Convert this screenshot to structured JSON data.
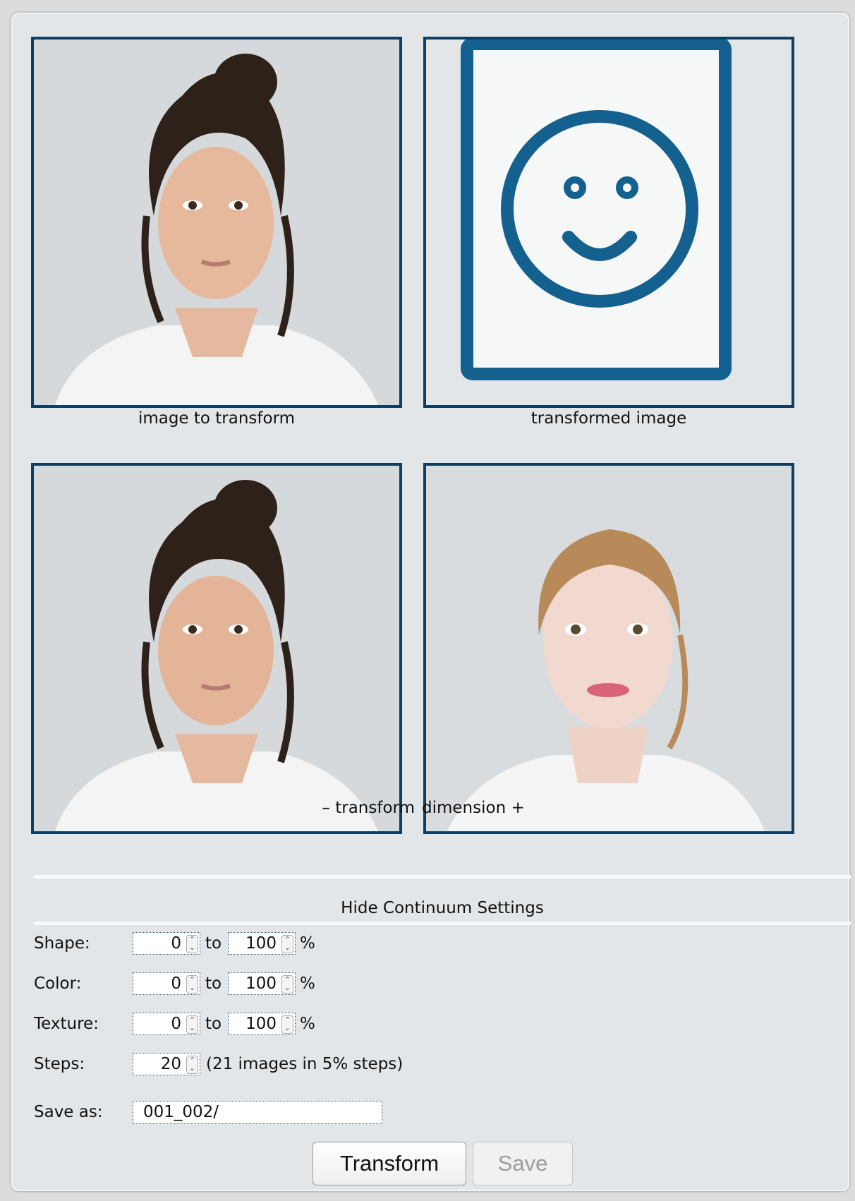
{
  "images": {
    "source_caption": "image to transform",
    "result_caption": "transformed image",
    "continuum_left_caption": "– transform",
    "continuum_right_caption": "dimension +"
  },
  "settings": {
    "toggle_label": "Hide Continuum Settings",
    "shape": {
      "label": "Shape:",
      "from": "0",
      "to_word": "to",
      "to": "100",
      "unit": "%"
    },
    "color": {
      "label": "Color:",
      "from": "0",
      "to_word": "to",
      "to": "100",
      "unit": "%"
    },
    "texture": {
      "label": "Texture:",
      "from": "0",
      "to_word": "to",
      "to": "100",
      "unit": "%"
    },
    "steps": {
      "label": "Steps:",
      "value": "20",
      "note": "(21 images in 5% steps)"
    },
    "save_as": {
      "label": "Save as:",
      "value": "001_002/"
    }
  },
  "buttons": {
    "transform": "Transform",
    "save": "Save"
  },
  "colors": {
    "frame": "#0e3e61",
    "icon": "#14608e",
    "panel": "#e3e6e9"
  },
  "icons": {
    "placeholder": "smiley-face-icon"
  }
}
